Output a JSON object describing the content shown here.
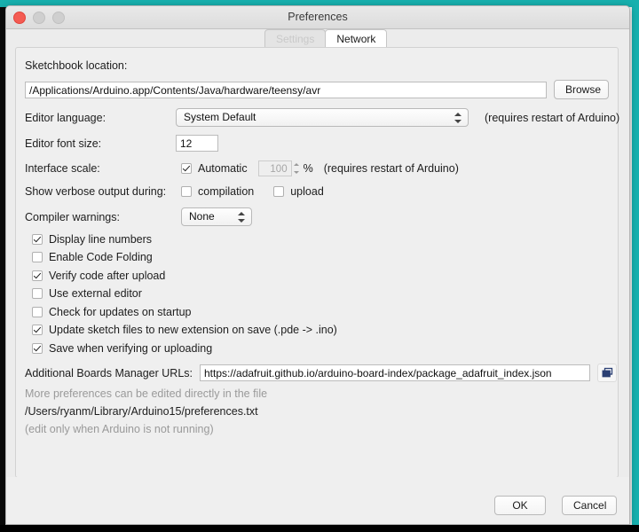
{
  "window": {
    "title": "Preferences",
    "traffic_lights": [
      "close-button",
      "minimize-button",
      "zoom-button"
    ]
  },
  "tabs": [
    {
      "label": "Settings",
      "state": "selected"
    },
    {
      "label": "Network",
      "state": "normal"
    }
  ],
  "sketchbook": {
    "label": "Sketchbook location:",
    "value": "/Applications/Arduino.app/Contents/Java/hardware/teensy/avr",
    "browse_label": "Browse"
  },
  "editor_language": {
    "label": "Editor language:",
    "value": "System Default",
    "note": "(requires restart of Arduino)"
  },
  "editor_font_size": {
    "label": "Editor font size:",
    "value": "12"
  },
  "interface_scale": {
    "label": "Interface scale:",
    "automatic_label": "Automatic",
    "automatic_checked": true,
    "scale_value": "100",
    "percent_label": "%",
    "note": "(requires restart of Arduino)"
  },
  "verbose_output": {
    "label": "Show verbose output during:",
    "options": [
      {
        "label": "compilation",
        "checked": false
      },
      {
        "label": "upload",
        "checked": false
      }
    ]
  },
  "compiler_warnings": {
    "label": "Compiler warnings:",
    "value": "None"
  },
  "checkboxes": [
    {
      "label": "Display line numbers",
      "checked": true
    },
    {
      "label": "Enable Code Folding",
      "checked": false
    },
    {
      "label": "Verify code after upload",
      "checked": true
    },
    {
      "label": "Use external editor",
      "checked": false
    },
    {
      "label": "Check for updates on startup",
      "checked": false
    },
    {
      "label": "Update sketch files to new extension on save (.pde -> .ino)",
      "checked": true
    },
    {
      "label": "Save when verifying or uploading",
      "checked": true
    }
  ],
  "boards_manager": {
    "label": "Additional Boards Manager URLs:",
    "value": "https://adafruit.github.io/arduino-board-index/package_adafruit_index.json",
    "edit_icon": "open-window-icon"
  },
  "more_prefs": {
    "line1": "More preferences can be edited directly in the file",
    "path": "/Users/ryanm/Library/Arduino15/preferences.txt",
    "line3": "(edit only when Arduino is not running)"
  },
  "footer": {
    "ok_label": "OK",
    "cancel_label": "Cancel"
  },
  "background": {
    "accent_color": "#17b0ae",
    "fragment_1": "9",
    "fragment_2": "5"
  }
}
